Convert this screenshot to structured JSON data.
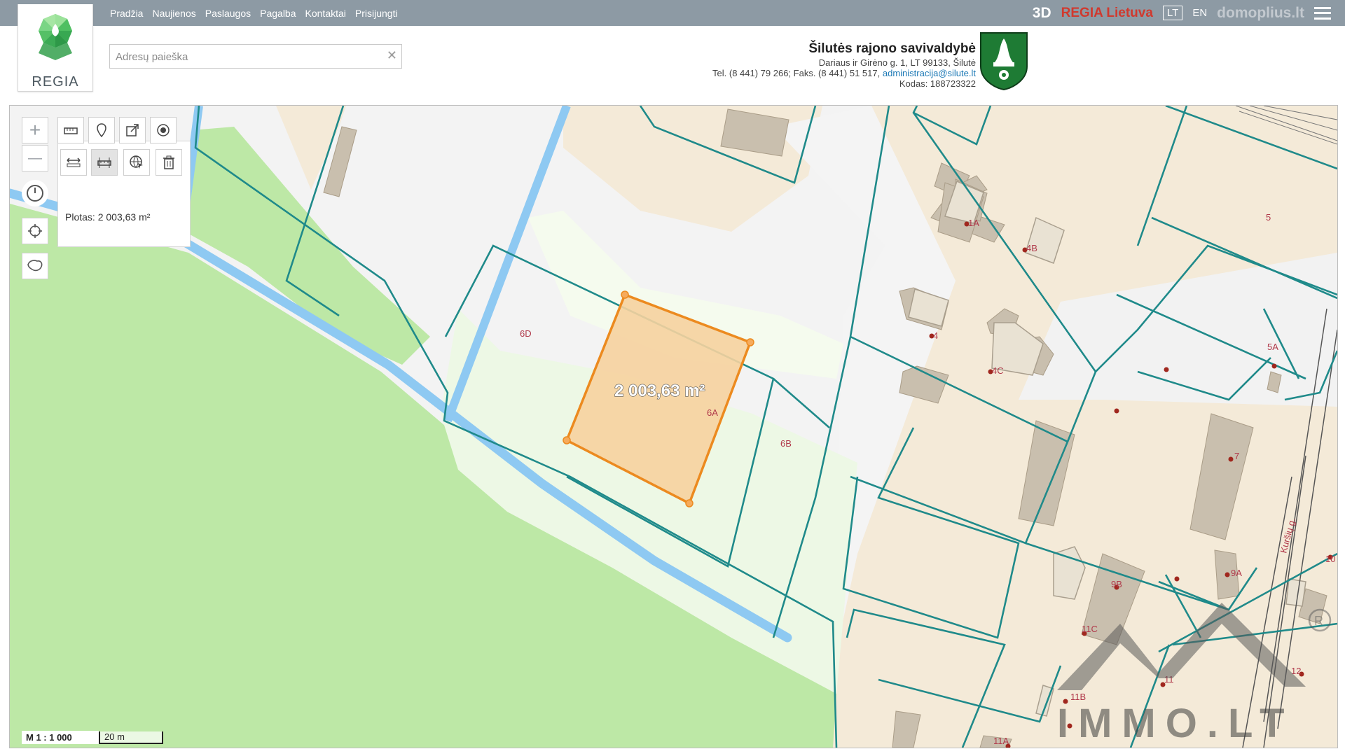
{
  "nav": {
    "items": [
      "Pradžia",
      "Naujienos",
      "Paslaugos",
      "Pagalba",
      "Kontaktai",
      "Prisijungti"
    ],
    "btn_3d": "3D",
    "regia_lietuva": "REGIA Lietuva",
    "lang_lt": "LT",
    "lang_en": "EN",
    "watermark": "domoplius.lt"
  },
  "logo": {
    "text": "REGIA"
  },
  "search": {
    "placeholder": "Adresų paieška",
    "value": ""
  },
  "municipality": {
    "name": "Šilutės rajono savivaldybė",
    "address": "Dariaus ir Girėno g. 1, LT 99133, Šilutė",
    "phone": "Tel. (8 441) 79 266; Faks. (8 441) 51 517,",
    "email": "administracija@silute.lt",
    "code": "Kodas: 188723322"
  },
  "map": {
    "area_info": "Plotas: 2 003,63 m²",
    "measure_label": "2 003,63 m²",
    "scale_ratio": "M 1 : 1 000",
    "scale_bar": "20 m",
    "parcels": [
      "6D",
      "6A",
      "6B",
      "5",
      "1A",
      "4B",
      "4",
      "4C",
      "5A",
      "7",
      "10",
      "9A",
      "9B",
      "11C",
      "11",
      "12",
      "11B",
      "11A"
    ],
    "street": "Kuršių g.",
    "watermark": "IMMO.LT",
    "colors": {
      "parcel_line": "#1f8a8a",
      "water": "#8ec9f2",
      "green": "#bde8a6",
      "building_area": "#f4ead8",
      "measure_fill": "#f6d29e",
      "measure_line": "#ec8a1f"
    }
  },
  "toolbar": {
    "zoom_in": "+",
    "zoom_out": "—"
  }
}
